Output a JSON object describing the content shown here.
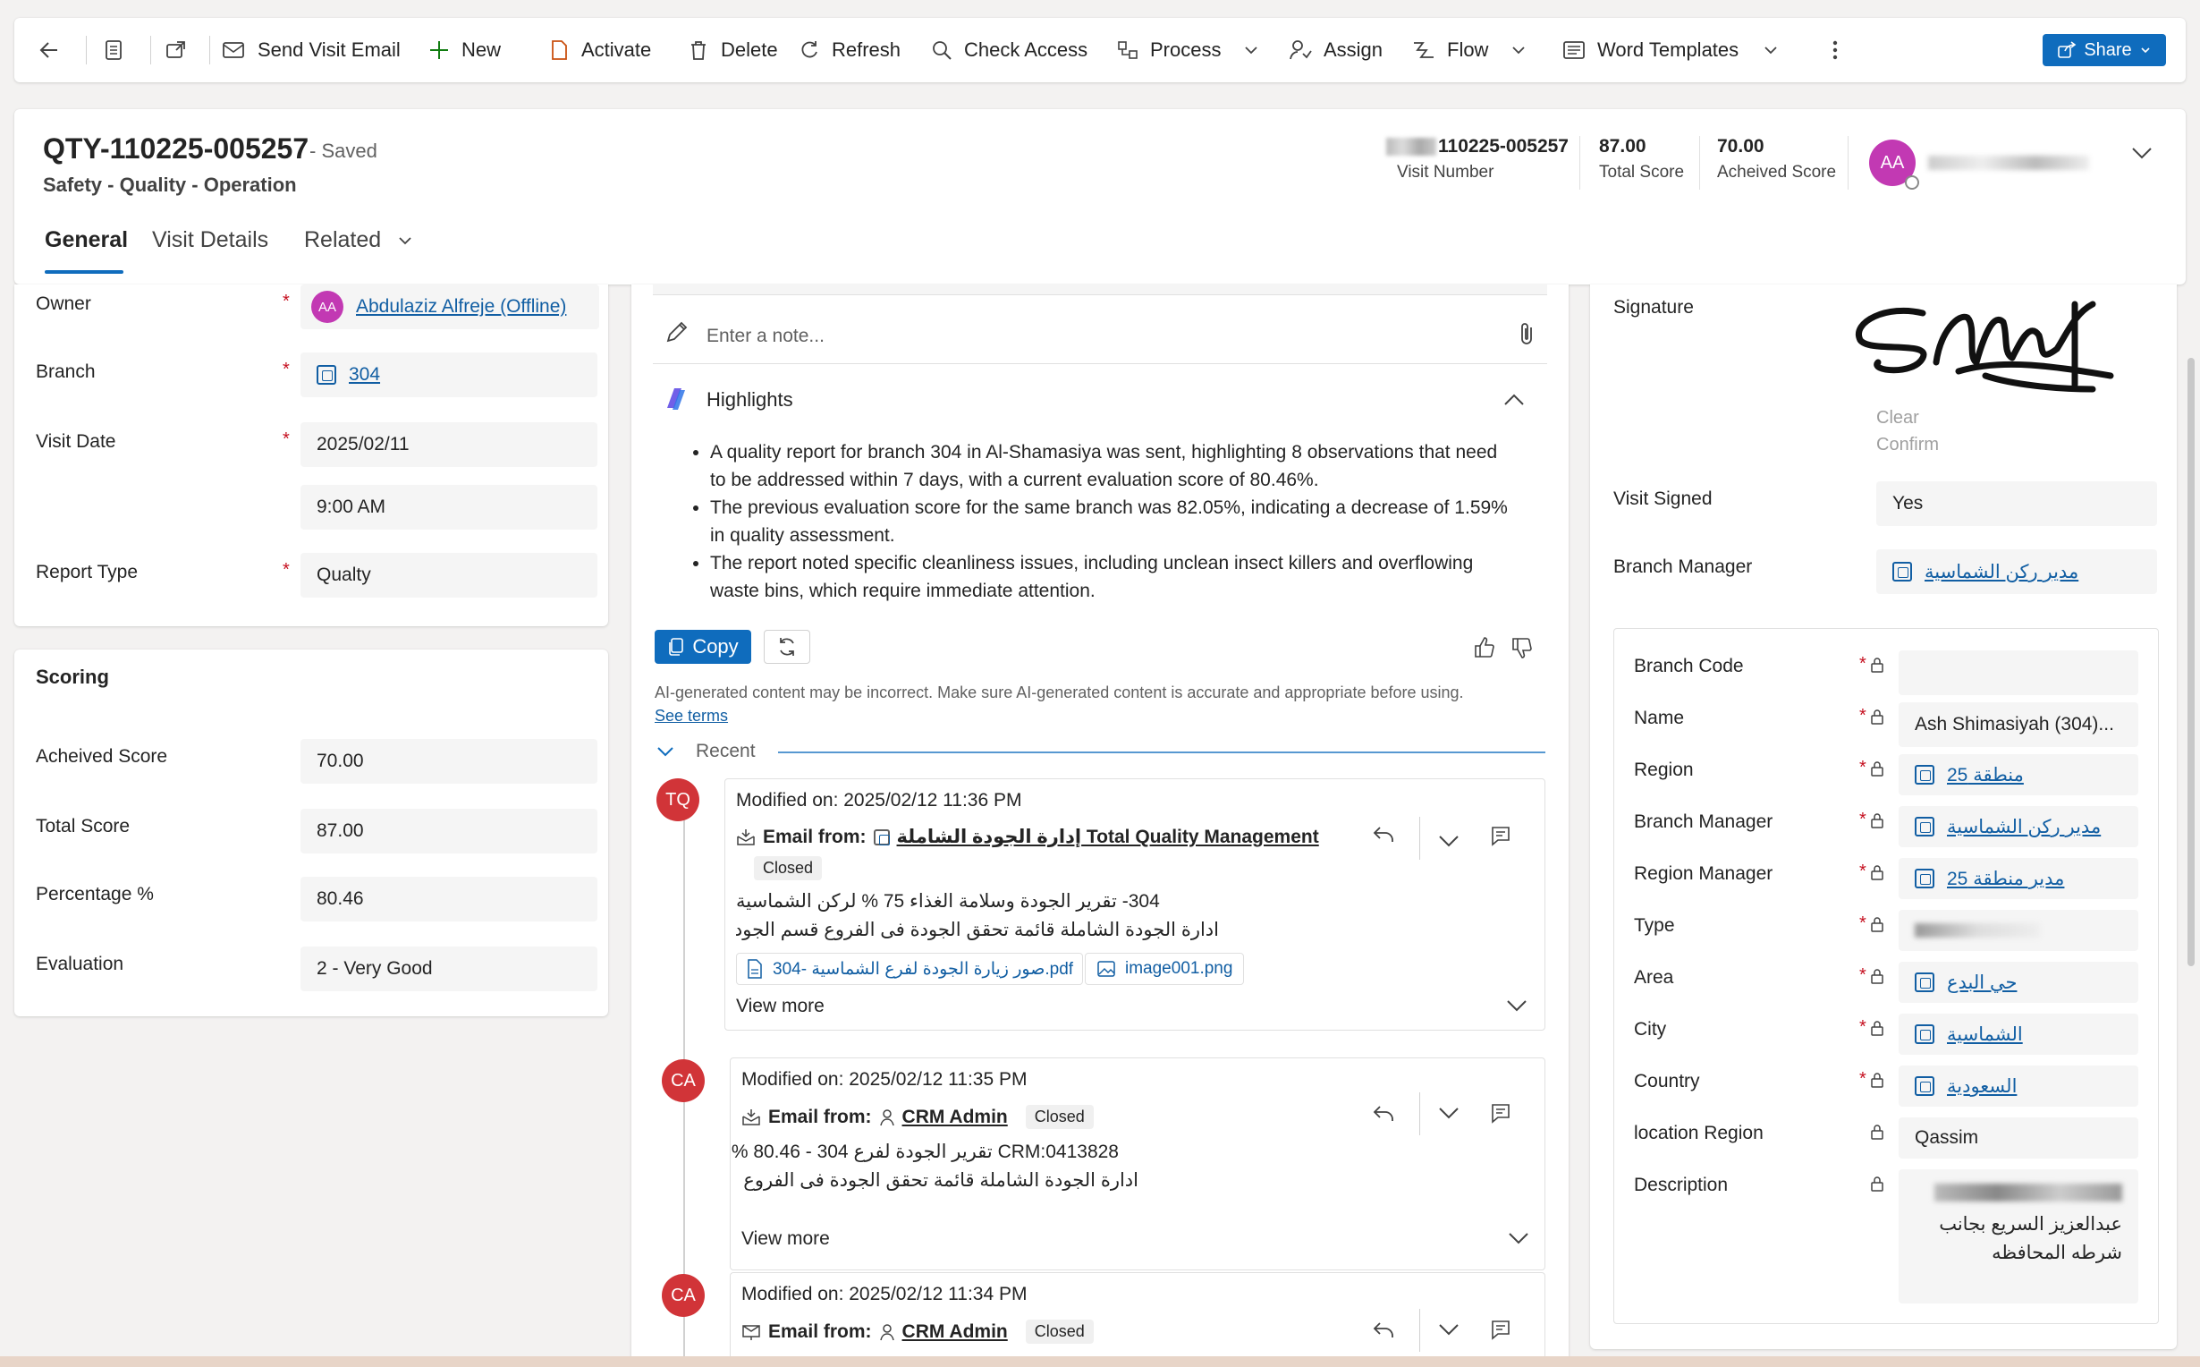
{
  "command_bar": {
    "send_visit_email": "Send Visit Email",
    "new": "New",
    "activate": "Activate",
    "delete": "Delete",
    "refresh": "Refresh",
    "check_access": "Check Access",
    "process": "Process",
    "assign": "Assign",
    "flow": "Flow",
    "word_templates": "Word Templates",
    "share": "Share"
  },
  "header": {
    "title": "QTY-110225-005257",
    "status": "- Saved",
    "subtitle": "Safety - Quality - Operation",
    "fields": [
      {
        "value": "110225-005257",
        "label": "Visit Number"
      },
      {
        "value": "87.00",
        "label": "Total Score"
      },
      {
        "value": "70.00",
        "label": "Acheived Score"
      }
    ],
    "owner_initials": "AA"
  },
  "tabs": {
    "general": "General",
    "visit_details": "Visit Details",
    "related": "Related"
  },
  "general": {
    "owner_label": "Owner",
    "owner_value": "Abdulaziz Alfreje (Offline)",
    "owner_initials": "AA",
    "branch_label": "Branch",
    "branch_value": "304",
    "visit_date_label": "Visit Date",
    "visit_date_value": "2025/02/11",
    "visit_time_value": "9:00 AM",
    "report_type_label": "Report Type",
    "report_type_value": "Qualty"
  },
  "scoring": {
    "title": "Scoring",
    "achieved_label": "Acheived Score",
    "achieved_value": "70.00",
    "total_label": "Total Score",
    "total_value": "87.00",
    "percentage_label": "Percentage %",
    "percentage_value": "80.46",
    "evaluation_label": "Evaluation",
    "evaluation_value": "2 - Very Good"
  },
  "timeline": {
    "note_placeholder": "Enter a note...",
    "highlights_title": "Highlights",
    "highlights": [
      "A quality report for branch 304 in Al-Shamasiya was sent, highlighting 8 observations that need to be addressed within 7 days, with a current evaluation score of 80.46%.",
      "The previous evaluation score for the same branch was 82.05%, indicating a decrease of 1.59% in quality assessment.",
      "The report noted specific cleanliness issues, including unclean insect killers and overflowing waste bins, which require immediate attention."
    ],
    "copy_label": "Copy",
    "disclaimer": "AI-generated content may be incorrect. Make sure AI-generated content is accurate and appropriate before using.",
    "see_terms": "See terms",
    "recent_label": "Recent",
    "email_from_label": "Email from:",
    "view_more": "View more",
    "entries": [
      {
        "initials": "TQ",
        "modified": "Modified on: 2025/02/12 11:36 PM",
        "from": "إدارة الجودة الشاملة Total Quality Management",
        "status": "Closed",
        "line1": "304- تقرير الجودة وسلامة الغذاء 75 % لركن الشماسية",
        "line2": "ادارة الجودة الشاملة قائمة تحقق الجودة فى الفروع قسم الجودة   رقم الزيارة",
        "attachment1": "304- صور زيارة الجودة لفرع الشماسية.pdf",
        "attachment2": "image001.png"
      },
      {
        "initials": "CA",
        "modified": "Modified on: 2025/02/12 11:35 PM",
        "from": "CRM Admin",
        "status": "Closed",
        "line1": "CRM:0413828 تقرير الجودة لفرع 304 - 80.46 %",
        "line2": "ادارة الجودة الشاملة قائمة تحقق الجودة فى الفروع قسم الجودة   رقم الزيارة"
      },
      {
        "initials": "CA",
        "modified": "Modified on: 2025/02/12 11:34 PM",
        "from": "CRM Admin",
        "status": "Closed"
      }
    ]
  },
  "right_panel": {
    "signature_label": "Signature",
    "clear": "Clear",
    "confirm": "Confirm",
    "visit_signed_label": "Visit Signed",
    "visit_signed_value": "Yes",
    "branch_manager_label": "Branch Manager",
    "branch_manager_value": "مدير ركن الشماسية",
    "branch": {
      "code_label": "Branch Code",
      "name_label": "Name",
      "name_value": "Ash Shimasiyah (304)...",
      "region_label": "Region",
      "region_value": "منطقة 25",
      "manager_label": "Branch Manager",
      "manager_value": "مدير ركن الشماسية",
      "region_manager_label": "Region Manager",
      "region_manager_value": "مدير منطقة 25",
      "type_label": "Type",
      "area_label": "Area",
      "area_value": "حي البدع",
      "city_label": "City",
      "city_value": "الشماسية",
      "country_label": "Country",
      "country_value": "السعودية",
      "location_region_label": "location Region",
      "location_region_value": "Qassim",
      "description_label": "Description",
      "description_value": "عبدالعزيز السريع بجانب شرطه المحافظه"
    }
  }
}
